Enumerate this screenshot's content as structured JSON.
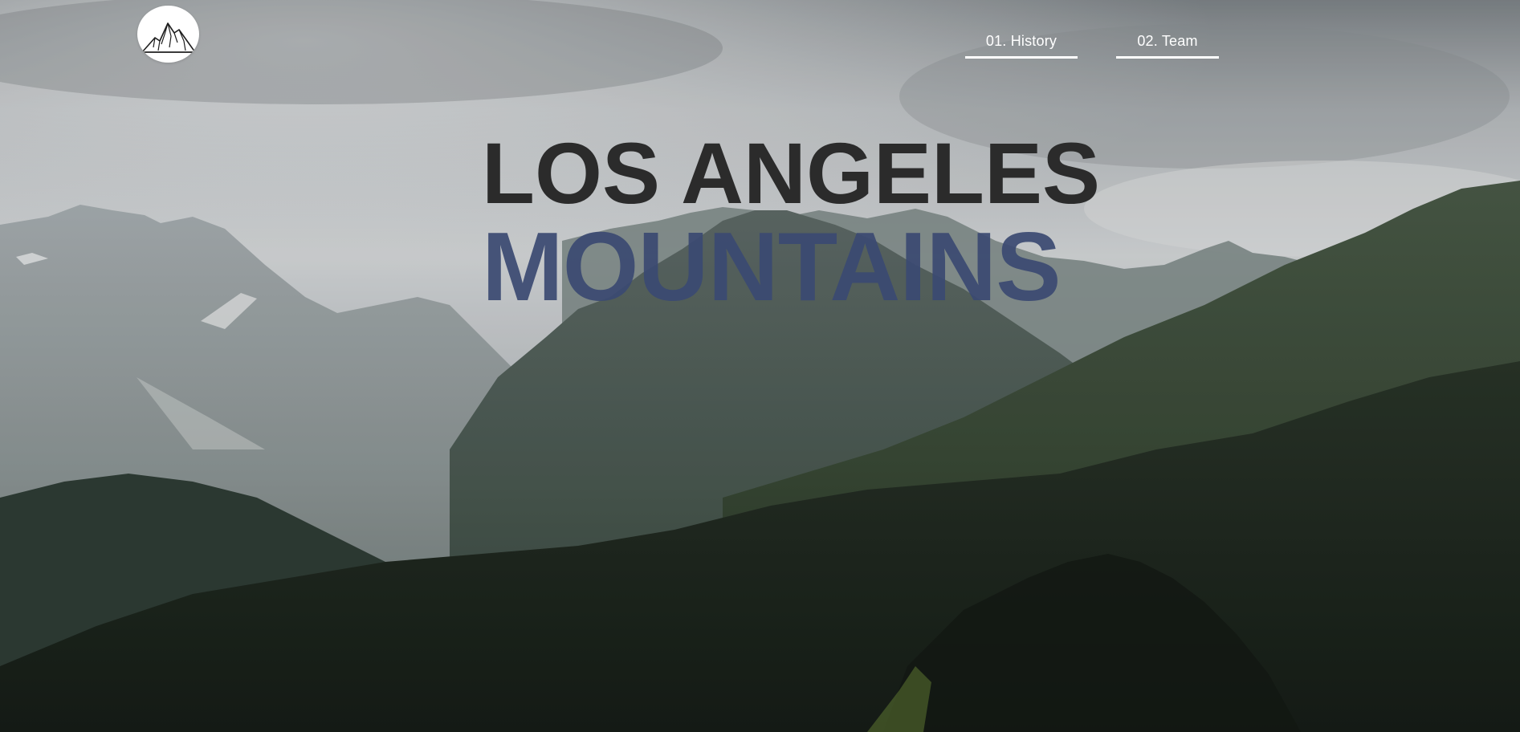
{
  "logo": {
    "icon": "mountain-logo-icon"
  },
  "nav": {
    "items": [
      {
        "label": "01. History"
      },
      {
        "label": "02. Team"
      }
    ]
  },
  "hero": {
    "title_line1": "LOS ANGELES",
    "title_line2": "MOUNTAINS"
  },
  "colors": {
    "title_dark": "#2b2b2b",
    "title_accent": "#3b4a72",
    "nav_text": "#ffffff",
    "sky": "#c9cdd0",
    "forest": "#1f2a24"
  }
}
